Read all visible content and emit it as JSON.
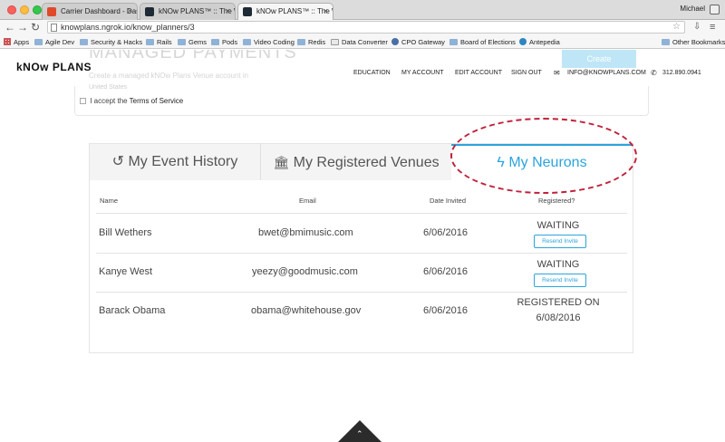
{
  "browser": {
    "tabs": [
      {
        "title": "Carrier Dashboard - Dashi",
        "favicon_color": "#e04a2a"
      },
      {
        "title": "kNOw PLANS™ :: The Wo",
        "favicon_color": "#1e2b36"
      },
      {
        "title": "kNOw PLANS™ :: The Wo",
        "favicon_color": "#1e2b36"
      }
    ],
    "user": "Michael",
    "url": "knowplans.ngrok.io/know_planners/3",
    "bookmarks": [
      "Apps",
      "Agile Dev",
      "Security & Hacks",
      "Rails",
      "Gems",
      "Pods",
      "Video Coding",
      "Redis",
      "Data Converter",
      "CPO Gateway",
      "Board of Elections",
      "Antepedia",
      "Other Bookmarks"
    ]
  },
  "background": {
    "title": "MANAGED PAYMENTS",
    "subtitle": "Create a managed kNOw Plans Venue account in",
    "country": "United States",
    "button": "Create",
    "terms_prefix": "I accept the",
    "terms_link": "Terms of Service"
  },
  "navbar": {
    "logo": "kNOw PLANS",
    "links": [
      "EDUCATION",
      "MY ACCOUNT",
      "EDIT ACCOUNT",
      "SIGN OUT"
    ],
    "email": "INFO@KNOWPLANS.COM",
    "phone": "312.890.0941"
  },
  "panel": {
    "tabs": [
      {
        "icon": "↺",
        "label": "My Event History"
      },
      {
        "icon": "🏛",
        "label": "My Registered Venues"
      },
      {
        "icon": "ϟ",
        "label": "My Neurons"
      }
    ],
    "active_tab": 2,
    "accent": "#2ca4dc",
    "columns": [
      "Name",
      "Email",
      "Date Invited",
      "Registered?"
    ],
    "rows": [
      {
        "name": "Bill Wethers",
        "email": "bwet@bmimusic.com",
        "date": "6/06/2016",
        "status": "WAITING",
        "status2": "",
        "action": "Resend Invite"
      },
      {
        "name": "Kanye West",
        "email": "yeezy@goodmusic.com",
        "date": "6/06/2016",
        "status": "WAITING",
        "status2": "",
        "action": "Resend Invite"
      },
      {
        "name": "Barack Obama",
        "email": "obama@whitehouse.gov",
        "date": "6/06/2016",
        "status": "REGISTERED ON",
        "status2": "6/08/2016",
        "action": ""
      }
    ]
  },
  "annotation_color": "#c0213a",
  "scroll_top_icon": "chevron-up-icon"
}
